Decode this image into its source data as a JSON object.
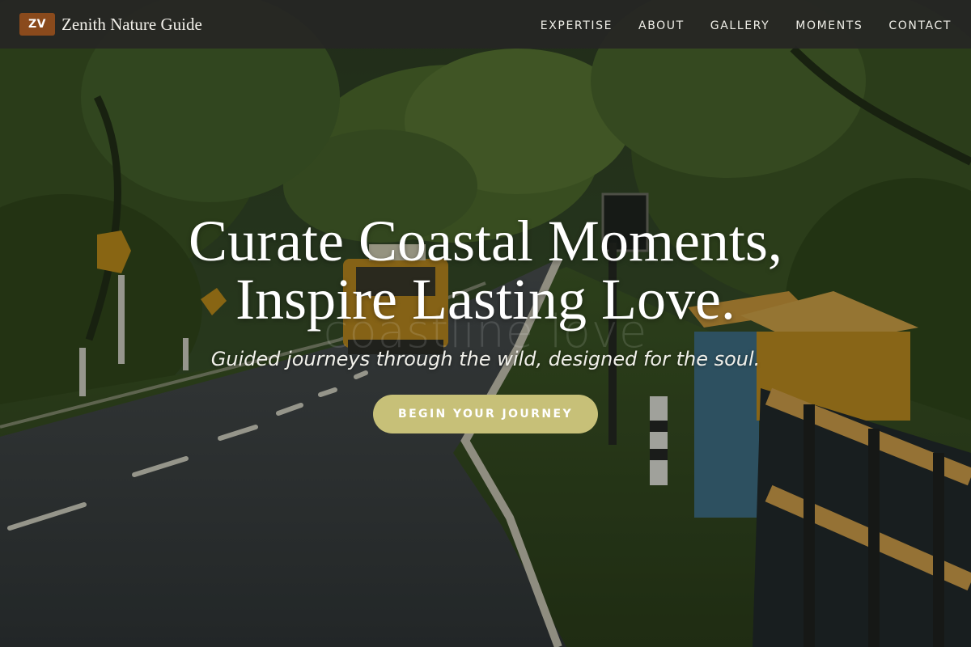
{
  "theme": {
    "logo_color": "#8a4a1c",
    "cta_color": "#c7c078",
    "nav_background": "#262624"
  },
  "brand": {
    "logo_text": "ZV",
    "name": "Zenith Nature Guide"
  },
  "nav": {
    "links": [
      {
        "label": "EXPERTISE"
      },
      {
        "label": "ABOUT"
      },
      {
        "label": "GALLERY"
      },
      {
        "label": "MOMENTS"
      },
      {
        "label": "CONTACT"
      }
    ]
  },
  "hero": {
    "watermark": "coastline love",
    "headline_line1": "Curate Coastal Moments,",
    "headline_line2": "Inspire Lasting Love.",
    "tagline": "Guided journeys through the wild, designed for the soul.",
    "cta_label": "BEGIN YOUR JOURNEY",
    "background_description_icon": "forest-road-photo"
  }
}
